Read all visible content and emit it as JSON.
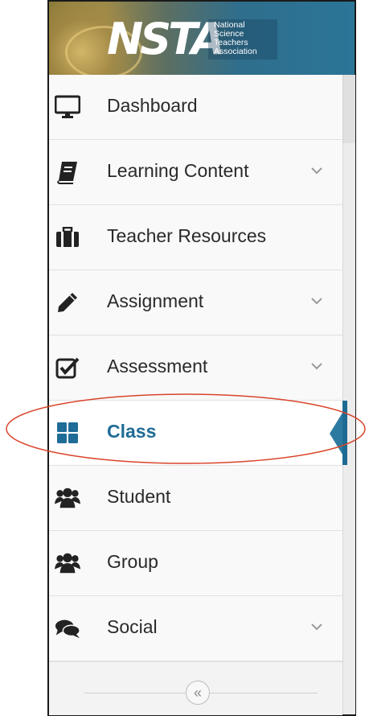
{
  "logo": {
    "wordmark": "NSTA",
    "subtitle_lines": [
      "National",
      "Science",
      "Teachers",
      "Association"
    ]
  },
  "nav": [
    {
      "key": "dashboard",
      "label": "Dashboard",
      "icon": "monitor-icon",
      "has_chevron": false
    },
    {
      "key": "learning-content",
      "label": "Learning Content",
      "icon": "book-icon",
      "has_chevron": true
    },
    {
      "key": "teacher-resources",
      "label": "Teacher Resources",
      "icon": "briefcase-icon",
      "has_chevron": false
    },
    {
      "key": "assignment",
      "label": "Assignment",
      "icon": "pencil-icon",
      "has_chevron": true
    },
    {
      "key": "assessment",
      "label": "Assessment",
      "icon": "checkbox-icon",
      "has_chevron": true
    },
    {
      "key": "class",
      "label": "Class",
      "icon": "grid-icon",
      "has_chevron": false,
      "active": true
    },
    {
      "key": "student",
      "label": "Student",
      "icon": "users-icon",
      "has_chevron": false
    },
    {
      "key": "group",
      "label": "Group",
      "icon": "users-icon",
      "has_chevron": false
    },
    {
      "key": "social",
      "label": "Social",
      "icon": "comments-icon",
      "has_chevron": true
    }
  ],
  "collapse": {
    "label": "«"
  },
  "colors": {
    "accent": "#1f6c97",
    "highlight_ellipse": "#d9452a",
    "text": "#2a2a2a"
  }
}
